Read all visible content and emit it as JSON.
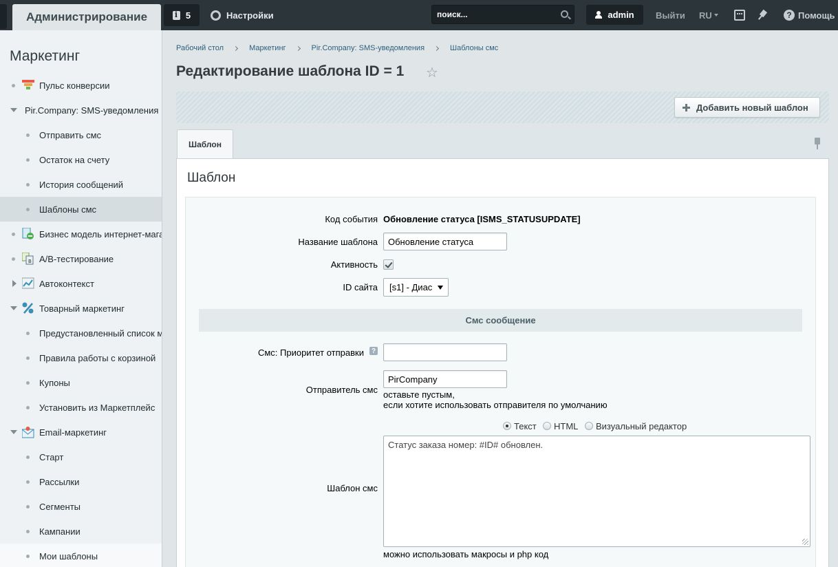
{
  "topbar": {
    "admin_label": "Администрирование",
    "notifications_count": "5",
    "settings_label": "Настройки",
    "search_placeholder": "поиск...",
    "user_name": "admin",
    "logout_label": "Выйти",
    "lang_label": "RU",
    "help_label": "Помощь"
  },
  "sidebar": {
    "title": "Маркетинг",
    "items": [
      {
        "label": "Пульс конверсии"
      },
      {
        "label": "Pir.Company: SMS-уведомления"
      },
      {
        "label": "Отправить смс"
      },
      {
        "label": "Остаток на счету"
      },
      {
        "label": "История сообщений"
      },
      {
        "label": "Шаблоны смс"
      },
      {
        "label": "Бизнес модель интернет-магазина"
      },
      {
        "label": "A/B-тестирование"
      },
      {
        "label": "Автоконтекст"
      },
      {
        "label": "Товарный маркетинг"
      },
      {
        "label": "Предустановленный список маркетинговых"
      },
      {
        "label": "Правила работы с корзиной"
      },
      {
        "label": "Купоны"
      },
      {
        "label": "Установить из Маркетплейс"
      },
      {
        "label": "Email-маркетинг"
      },
      {
        "label": "Старт"
      },
      {
        "label": "Рассылки"
      },
      {
        "label": "Сегменты"
      },
      {
        "label": "Кампании"
      },
      {
        "label": "Мои шаблоны"
      }
    ]
  },
  "breadcrumbs": [
    "Рабочий стол",
    "Маркетинг",
    "Pir.Company: SMS-уведомления",
    "Шаблоны смс"
  ],
  "page_title": "Редактирование шаблона ID = 1",
  "toolbar": {
    "add_label": "Добавить новый шаблон"
  },
  "tabs": [
    {
      "label": "Шаблон"
    }
  ],
  "form": {
    "title": "Шаблон",
    "event_code_label": "Код события",
    "event_code_value": "Обновление статуса [ISMS_STATUSUPDATE]",
    "name_label": "Название шаблона",
    "name_value": "Обновление статуса",
    "active_label": "Активность",
    "active_checked": true,
    "site_label": "ID сайта",
    "site_value": "[s1] - Диас",
    "section_title": "Смс сообщение",
    "priority_label": "Смс: Приоритет отправки",
    "priority_value": "",
    "priority_help": "?",
    "sender_label": "Отправитель смс",
    "sender_value": "PirCompany",
    "sender_hint_1": "оставьте пустым,",
    "sender_hint_2": "если хотите использовать отправителя по умолчанию",
    "modes": [
      {
        "label": "Текст",
        "selected": true
      },
      {
        "label": "HTML",
        "selected": false
      },
      {
        "label": "Визуальный редактор",
        "selected": false
      }
    ],
    "template_label": "Шаблон смс",
    "template_value": "Статус заказа номер: #ID# обновлен.",
    "template_hint": "можно использовать макросы и php код"
  }
}
